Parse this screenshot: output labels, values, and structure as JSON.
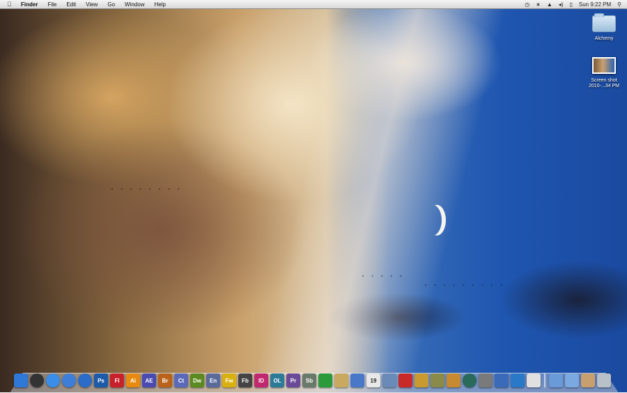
{
  "menubar": {
    "apple_icon": "apple-icon",
    "items": [
      "Finder",
      "File",
      "Edit",
      "View",
      "Go",
      "Window",
      "Help"
    ],
    "status": {
      "clock": "Sun 9:22 PM",
      "icons": [
        "time-machine-icon",
        "bluetooth-icon",
        "wifi-icon",
        "volume-icon",
        "battery-icon",
        "spotlight-icon"
      ]
    }
  },
  "desktop": {
    "icons": [
      {
        "label": "Alchemy",
        "type": "folder"
      },
      {
        "label_line1": "Screen shot",
        "label_line2": "2010-...34 PM",
        "type": "screenshot"
      }
    ]
  },
  "dock": {
    "apps": [
      {
        "name": "finder",
        "label": "",
        "color": "#2f78d8"
      },
      {
        "name": "dashboard",
        "label": "",
        "color": "#333333"
      },
      {
        "name": "ichat",
        "label": "",
        "color": "#3a8ee8"
      },
      {
        "name": "safari",
        "label": "",
        "color": "#3d7ed8"
      },
      {
        "name": "itunes",
        "label": "",
        "color": "#2a6cc8"
      },
      {
        "name": "photoshop",
        "label": "Ps",
        "color": "#1d5aa8"
      },
      {
        "name": "flash",
        "label": "Fl",
        "color": "#c8202a"
      },
      {
        "name": "illustrator",
        "label": "Ai",
        "color": "#e88a10"
      },
      {
        "name": "after-effects",
        "label": "AE",
        "color": "#4a4ab0"
      },
      {
        "name": "bridge",
        "label": "Br",
        "color": "#b8621a"
      },
      {
        "name": "contribute",
        "label": "Ct",
        "color": "#5a6ab8"
      },
      {
        "name": "dreamweaver",
        "label": "Dw",
        "color": "#5a8a20"
      },
      {
        "name": "encore",
        "label": "En",
        "color": "#5a6a9a"
      },
      {
        "name": "fireworks",
        "label": "Fw",
        "color": "#d8b010"
      },
      {
        "name": "flash-builder",
        "label": "Fb",
        "color": "#444444"
      },
      {
        "name": "indesign",
        "label": "ID",
        "color": "#c02870"
      },
      {
        "name": "onlocation",
        "label": "OL",
        "color": "#2a7a98"
      },
      {
        "name": "premiere",
        "label": "Pr",
        "color": "#6a4a98"
      },
      {
        "name": "soundbooth",
        "label": "Sb",
        "color": "#6a7a6a"
      },
      {
        "name": "app-store-style",
        "label": "",
        "color": "#2a9a3a"
      },
      {
        "name": "notes",
        "label": "",
        "color": "#c9a860"
      },
      {
        "name": "preview",
        "label": "",
        "color": "#4a78c8"
      },
      {
        "name": "ical",
        "label": "19",
        "color": "#e8e8e8"
      },
      {
        "name": "iphoto",
        "label": "",
        "color": "#6a8ab8"
      },
      {
        "name": "photo-booth",
        "label": "",
        "color": "#c82a2a"
      },
      {
        "name": "image-capture",
        "label": "",
        "color": "#c89a30"
      },
      {
        "name": "dashcode",
        "label": "",
        "color": "#8a8a4a"
      },
      {
        "name": "garageband",
        "label": "",
        "color": "#c88a30"
      },
      {
        "name": "time-machine",
        "label": "",
        "color": "#2a6a5a"
      },
      {
        "name": "system-preferences",
        "label": "",
        "color": "#7a7a7a"
      },
      {
        "name": "bbedit",
        "label": "",
        "color": "#3a6ab8"
      },
      {
        "name": "users",
        "label": "",
        "color": "#2a78c8"
      },
      {
        "name": "textedit",
        "label": "",
        "color": "#e0e0e0"
      },
      {
        "name": "applications-stack",
        "label": "",
        "color": "#6a9ad8"
      },
      {
        "name": "documents-stack",
        "label": "",
        "color": "#7aa8e0"
      },
      {
        "name": "downloads-stack",
        "label": "",
        "color": "#c8a070"
      },
      {
        "name": "trash",
        "label": "",
        "color": "#b8c0c8"
      }
    ]
  }
}
